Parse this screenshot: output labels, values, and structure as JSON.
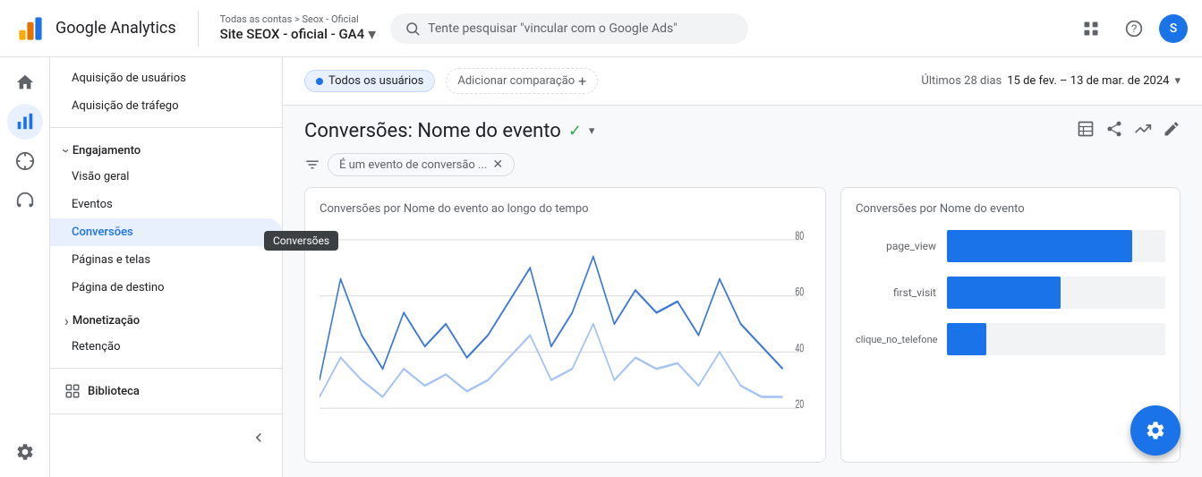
{
  "topbar": {
    "logo_text": "Google Analytics",
    "breadcrumb": "Todas as contas > Seox - Oficial",
    "property": "Site SEOX - oficial - GA4",
    "search_placeholder": "Tente pesquisar \"vincular com o Google Ads\"",
    "avatar_letter": "S"
  },
  "segment_bar": {
    "segment_label": "Todos os usuários",
    "add_comparison": "Adicionar comparação",
    "date_label": "Últimos 28 dias",
    "date_range": "15 de fev. – 13 de mar. de 2024"
  },
  "report": {
    "title": "Conversões: Nome do evento",
    "filter_label": "É um evento de conversão ..."
  },
  "line_chart": {
    "title": "Conversões por Nome do evento ao longo do tempo",
    "y_labels": [
      "80",
      "60",
      "40",
      "20"
    ]
  },
  "bar_chart": {
    "title": "Conversões por Nome do evento",
    "bars": [
      {
        "label": "page_view",
        "value": 85,
        "max": 100
      },
      {
        "label": "first_visit",
        "value": 52,
        "max": 100
      },
      {
        "label": "clique_no_telefone",
        "value": 18,
        "max": 100
      }
    ]
  },
  "sidebar": {
    "items": [
      {
        "label": "Aquisição de usuários",
        "level": 2
      },
      {
        "label": "Aquisição de tráfego",
        "level": 2
      },
      {
        "label": "Engajamento",
        "level": 1,
        "expanded": true
      },
      {
        "label": "Visão geral",
        "level": 2
      },
      {
        "label": "Eventos",
        "level": 2
      },
      {
        "label": "Conversões",
        "level": 2,
        "active": true
      },
      {
        "label": "Páginas e telas",
        "level": 2
      },
      {
        "label": "Página de destino",
        "level": 2
      },
      {
        "label": "Monetização",
        "level": 1,
        "expanded": false
      },
      {
        "label": "Retenção",
        "level": 2
      },
      {
        "label": "Biblioteca",
        "level": 1,
        "library": true
      }
    ]
  },
  "tooltip": {
    "label": "Conversões"
  },
  "icons": {
    "home": "⌂",
    "reports": "📊",
    "explore": "🔍",
    "advertise": "📢",
    "settings": "⚙",
    "apps_grid": "⊞",
    "help": "?",
    "search": "🔍",
    "chevron_down": "▾",
    "chevron_right": "›",
    "fab": "⚙"
  }
}
